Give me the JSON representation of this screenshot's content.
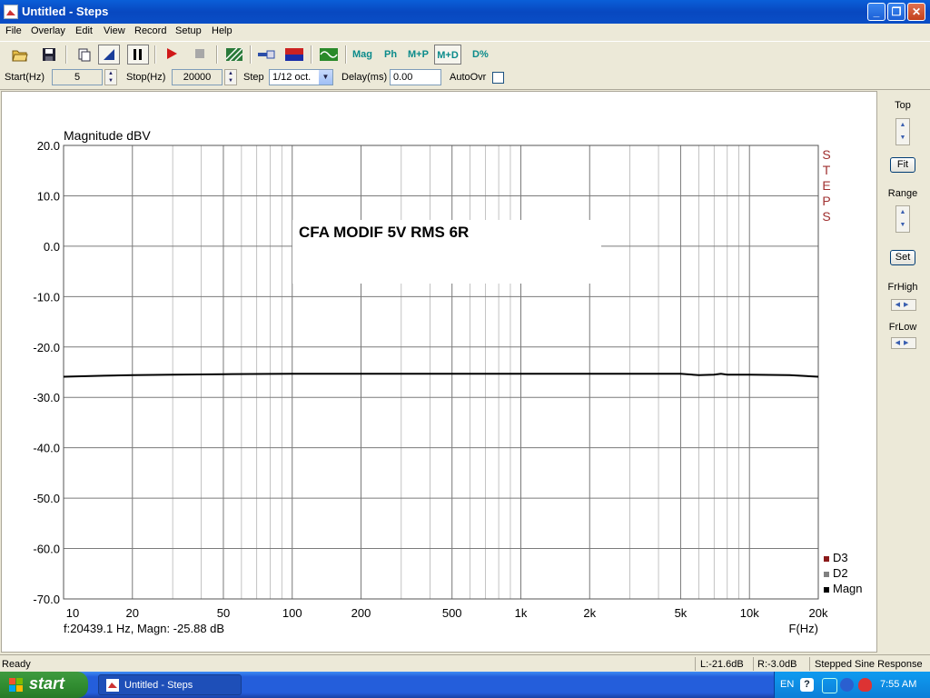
{
  "window": {
    "title": "Untitled - Steps"
  },
  "menu": [
    "File",
    "Overlay",
    "Edit",
    "View",
    "Record",
    "Setup",
    "Help"
  ],
  "toolbar": {
    "mag": "Mag",
    "ph": "Ph",
    "mp": "M+P",
    "md": "M+D",
    "dpct": "D%"
  },
  "params": {
    "start_label": "Start(Hz)",
    "start_value": "5",
    "stop_label": "Stop(Hz)",
    "stop_value": "20000",
    "step_label": "Step",
    "step_value": "1/12 oct.",
    "delay_label": "Delay(ms)",
    "delay_value": "0.00",
    "autoovr_label": "AutoOvr"
  },
  "side": {
    "top": "Top",
    "fit": "Fit",
    "range": "Range",
    "set": "Set",
    "frhigh": "FrHigh",
    "frlow": "FrLow"
  },
  "status": {
    "ready": "Ready",
    "l": "L:-21.6dB",
    "r": "R:-3.0dB",
    "mode": "Stepped Sine Response"
  },
  "taskbar": {
    "start": "start",
    "task": "Untitled - Steps",
    "lang": "EN",
    "time": "7:55 AM"
  },
  "colors": {
    "grid": "#7a7a7a",
    "trace": "#000000",
    "steps_text": "#a03030",
    "d3": "#8b1a1a",
    "d2": "#808080"
  },
  "chart_data": {
    "type": "line",
    "ylabel": "Magnitude dBV",
    "xlabel": "F(Hz)",
    "annotation": "CFA MODIF 5V RMS 6R",
    "vertical_text": "STEPS",
    "cursor_readout": "f:20439.1 Hz, Magn: -25.88 dB",
    "xscale": "log",
    "xlim": [
      10,
      20000
    ],
    "ylim": [
      -70,
      20
    ],
    "yticks": [
      20,
      10,
      0,
      -10,
      -20,
      -30,
      -40,
      -50,
      -60,
      -70
    ],
    "ytick_labels": [
      "20.0",
      "10.0",
      "0.0",
      "-10.0",
      "-20.0",
      "-30.0",
      "-40.0",
      "-50.0",
      "-60.0",
      "-70.0"
    ],
    "xticks": [
      10,
      20,
      50,
      100,
      200,
      500,
      1000,
      2000,
      5000,
      10000,
      20000
    ],
    "xtick_labels": [
      "10",
      "20",
      "50",
      "100",
      "200",
      "500",
      "1k",
      "2k",
      "5k",
      "10k",
      "20k"
    ],
    "grid": true,
    "legend": [
      "D3",
      "D2",
      "Magn"
    ],
    "legend_position": "bottom-right",
    "series": [
      {
        "name": "Magn",
        "x": [
          10,
          15,
          20,
          30,
          50,
          100,
          200,
          500,
          1000,
          2000,
          5000,
          6000,
          7000,
          7500,
          8000,
          10000,
          15000,
          20000
        ],
        "y": [
          -25.9,
          -25.7,
          -25.6,
          -25.5,
          -25.4,
          -25.3,
          -25.3,
          -25.3,
          -25.3,
          -25.3,
          -25.3,
          -25.6,
          -25.5,
          -25.3,
          -25.5,
          -25.5,
          -25.6,
          -25.9
        ]
      }
    ]
  }
}
